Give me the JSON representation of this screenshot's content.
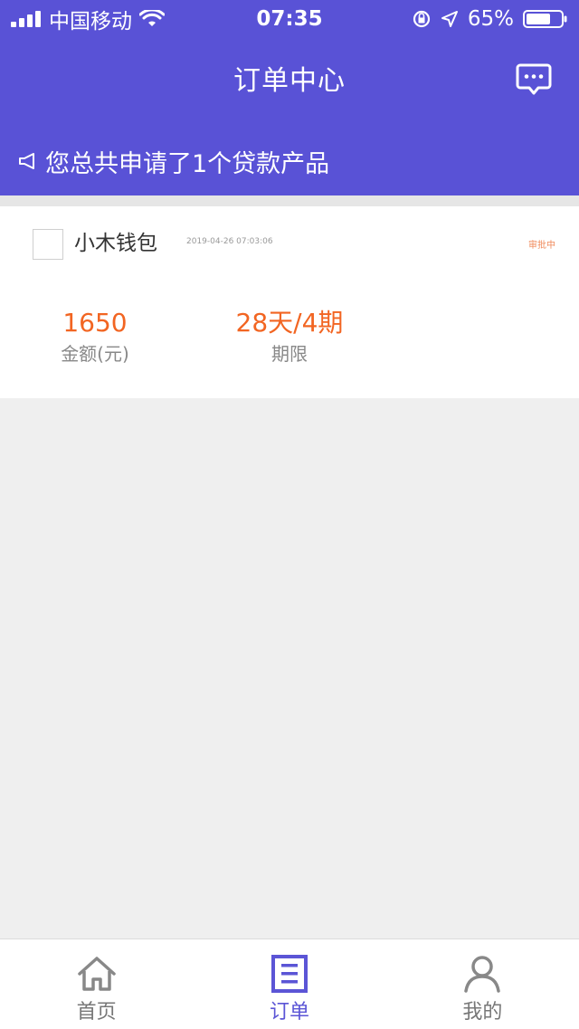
{
  "status_bar": {
    "carrier": "中国移动",
    "time": "07:35",
    "battery": "65%"
  },
  "nav": {
    "title": "订单中心",
    "message_icon": "chat-bubble-icon"
  },
  "notice": {
    "text": "您总共申请了1个贷款产品",
    "icon": "speaker-icon"
  },
  "orders": [
    {
      "name": "小木钱包",
      "date": "2019-04-26 07:03:06",
      "status": "审批中",
      "amount_value": "1650",
      "amount_label": "金额(元)",
      "term_value": "28天/4期",
      "term_label": "期限"
    }
  ],
  "tabs": [
    {
      "label": "首页",
      "icon": "home-icon",
      "active": false
    },
    {
      "label": "订单",
      "icon": "order-list-icon",
      "active": true
    },
    {
      "label": "我的",
      "icon": "profile-icon",
      "active": false
    }
  ],
  "colors": {
    "brand": "#5952d6",
    "accent_orange": "#f26522",
    "status_orange": "#f08a5b",
    "background": "#efefef"
  }
}
